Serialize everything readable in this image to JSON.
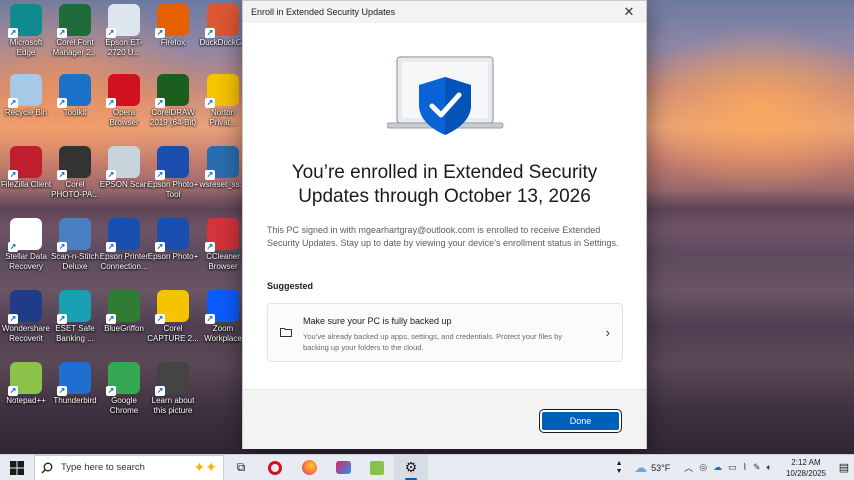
{
  "desktop": {
    "icons": [
      {
        "label": "Microsoft Edge",
        "icon": "edge-icon",
        "color": "#0f8b8d"
      },
      {
        "label": "Corel Font Manager 2...",
        "icon": "corel-font-icon",
        "color": "#1e6b3b"
      },
      {
        "label": "Epson ET-2720 U...",
        "icon": "epson-printer-icon",
        "color": "#dde6ef"
      },
      {
        "label": "Firefox",
        "icon": "firefox-icon",
        "color": "#e66000"
      },
      {
        "label": "DuckDuckGo",
        "icon": "duckduckgo-icon",
        "color": "#de5833"
      },
      {
        "label": "Recycle Bin",
        "icon": "recycle-bin-icon",
        "color": "#a8c8e8"
      },
      {
        "label": "Toolkit",
        "icon": "toolkit-icon",
        "color": "#1a73c8"
      },
      {
        "label": "Opera Browser",
        "icon": "opera-icon",
        "color": "#d21120"
      },
      {
        "label": "CorelDRAW 2019 (64-Bit)",
        "icon": "coreldraw-icon",
        "color": "#1b5e20"
      },
      {
        "label": "Norton Privat...",
        "icon": "norton-icon",
        "color": "#f7c400"
      },
      {
        "label": "FileZilla Client",
        "icon": "filezilla-icon",
        "color": "#bf1e2e"
      },
      {
        "label": "Corel PHOTO-PA...",
        "icon": "corel-photo-paint-icon",
        "color": "#333333"
      },
      {
        "label": "EPSON Scan",
        "icon": "epson-scan-icon",
        "color": "#c9d3dc"
      },
      {
        "label": "Epson Photo+ Tool",
        "icon": "epson-photo-tool-icon",
        "color": "#1a4fb0"
      },
      {
        "label": "wsreset_ss...",
        "icon": "wsreset-icon",
        "color": "#2b6cb0"
      },
      {
        "label": "Stellar Data Recovery",
        "icon": "stellar-icon",
        "color": "#ffffff"
      },
      {
        "label": "Scan-n-Stitch Deluxe",
        "icon": "scan-stitch-icon",
        "color": "#4a7fc1"
      },
      {
        "label": "Epson Printer Connection...",
        "icon": "epson-connection-icon",
        "color": "#1a4fb0"
      },
      {
        "label": "Epson Photo+",
        "icon": "epson-photo-plus-icon",
        "color": "#1a4fb0"
      },
      {
        "label": "CCleaner Browser",
        "icon": "ccleaner-icon",
        "color": "#d4343a"
      },
      {
        "label": "Wondershare Recoverit",
        "icon": "recoverit-icon",
        "color": "#1f3c88"
      },
      {
        "label": "ESET Safe Banking ...",
        "icon": "eset-icon",
        "color": "#19a0b5"
      },
      {
        "label": "BlueGriffon",
        "icon": "bluegriffon-icon",
        "color": "#2e7d32"
      },
      {
        "label": "Corel CAPTURE 2...",
        "icon": "corel-capture-icon",
        "color": "#f5c400"
      },
      {
        "label": "Zoom Workplace",
        "icon": "zoom-icon",
        "color": "#0b5cff"
      },
      {
        "label": "Notepad++",
        "icon": "notepad-plus-icon",
        "color": "#8bc34a"
      },
      {
        "label": "Thunderbird",
        "icon": "thunderbird-icon",
        "color": "#1f6fd1"
      },
      {
        "label": "Google Chrome",
        "icon": "chrome-icon",
        "color": "#34a853"
      },
      {
        "label": "Learn about this picture",
        "icon": "camera-icon",
        "color": "#444444"
      }
    ]
  },
  "dialog": {
    "title": "Enroll in Extended Security Updates",
    "heading": "You’re enrolled in Extended Security Updates through October 13, 2026",
    "description": "This PC signed in with mgearhartgray@outlook.com is enrolled to receive Extended Security Updates. Stay up to date by viewing your device’s enrollment status in Settings.",
    "suggested_label": "Suggested",
    "card": {
      "title": "Make sure your PC is fully backed up",
      "subtitle": "You’ve already backed up apps, settings, and credentials. Protect your files by backing up your folders to the cloud."
    },
    "done_label": "Done",
    "accent": "#005fb8"
  },
  "taskbar": {
    "search_placeholder": "Type here to search",
    "weather": "53°F",
    "time": "2:12 AM",
    "date": "10/28/2025"
  }
}
